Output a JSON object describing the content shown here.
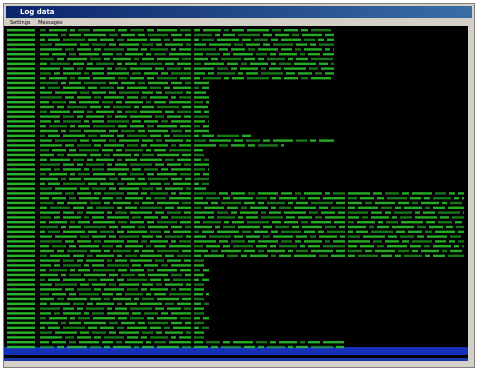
{
  "window": {
    "title": "Log data"
  },
  "menu": {
    "items": [
      "Settings",
      "Messages"
    ]
  },
  "log": {
    "text_color": "#2fd32f",
    "background": "#000000",
    "highlight_color": "#1530b8",
    "rows": [
      {
        "w": 330
      },
      {
        "w": 330
      },
      {
        "w": 330
      },
      {
        "w": 330
      },
      {
        "w": 330
      },
      {
        "w": 330
      },
      {
        "w": 330
      },
      {
        "w": 330
      },
      {
        "w": 330
      },
      {
        "w": 330
      },
      {
        "w": 330
      },
      {
        "w": 205
      },
      {
        "w": 205
      },
      {
        "w": 205
      },
      {
        "w": 205
      },
      {
        "w": 205
      },
      {
        "w": 205
      },
      {
        "w": 205
      },
      {
        "w": 205
      },
      {
        "w": 205
      },
      {
        "w": 205
      },
      {
        "w": 205
      },
      {
        "w": 250
      },
      {
        "w": 330
      },
      {
        "w": 280
      },
      {
        "w": 200
      },
      {
        "w": 200
      },
      {
        "w": 205
      },
      {
        "w": 205
      },
      {
        "w": 205
      },
      {
        "w": 205
      },
      {
        "w": 205
      },
      {
        "w": 205
      },
      {
        "w": 205
      },
      {
        "w": 460
      },
      {
        "w": 460
      },
      {
        "w": 460
      },
      {
        "w": 460
      },
      {
        "w": 460
      },
      {
        "w": 460
      },
      {
        "w": 460
      },
      {
        "w": 460
      },
      {
        "w": 460
      },
      {
        "w": 460
      },
      {
        "w": 460
      },
      {
        "w": 460
      },
      {
        "w": 460
      },
      {
        "w": 460
      },
      {
        "w": 200
      },
      {
        "w": 200
      },
      {
        "w": 205
      },
      {
        "w": 200
      },
      {
        "w": 205
      },
      {
        "w": 200
      },
      {
        "w": 200
      },
      {
        "w": 205
      },
      {
        "w": 200
      },
      {
        "w": 205
      },
      {
        "w": 200
      },
      {
        "w": 200
      },
      {
        "w": 205
      },
      {
        "w": 200
      },
      {
        "w": 205
      },
      {
        "w": 200
      },
      {
        "w": 200
      },
      {
        "w": 340
      },
      {
        "w": 340
      }
    ]
  }
}
